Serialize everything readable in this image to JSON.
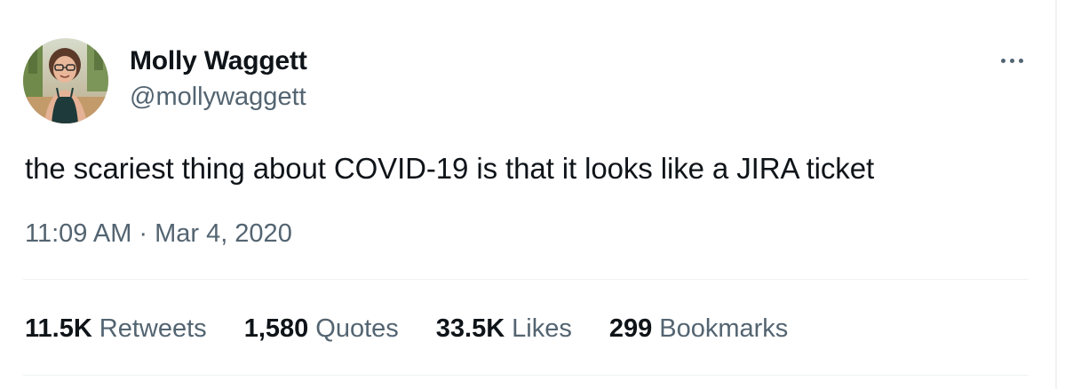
{
  "author": {
    "display_name": "Molly Waggett",
    "handle": "@mollywaggett",
    "avatar_icon": "profile-photo"
  },
  "tweet": {
    "text": "the scariest thing about COVID-19 is that it looks like a JIRA ticket",
    "time": "11:09 AM",
    "separator": "·",
    "date": "Mar 4, 2020"
  },
  "stats": [
    {
      "count": "11.5K",
      "label": "Retweets"
    },
    {
      "count": "1,580",
      "label": "Quotes"
    },
    {
      "count": "33.5K",
      "label": "Likes"
    },
    {
      "count": "299",
      "label": "Bookmarks"
    }
  ],
  "more_menu_icon": "more-horizontal-icon",
  "colors": {
    "primary_text": "#0f1419",
    "secondary_text": "#536471",
    "divider": "#eff3f4",
    "background": "#ffffff"
  }
}
